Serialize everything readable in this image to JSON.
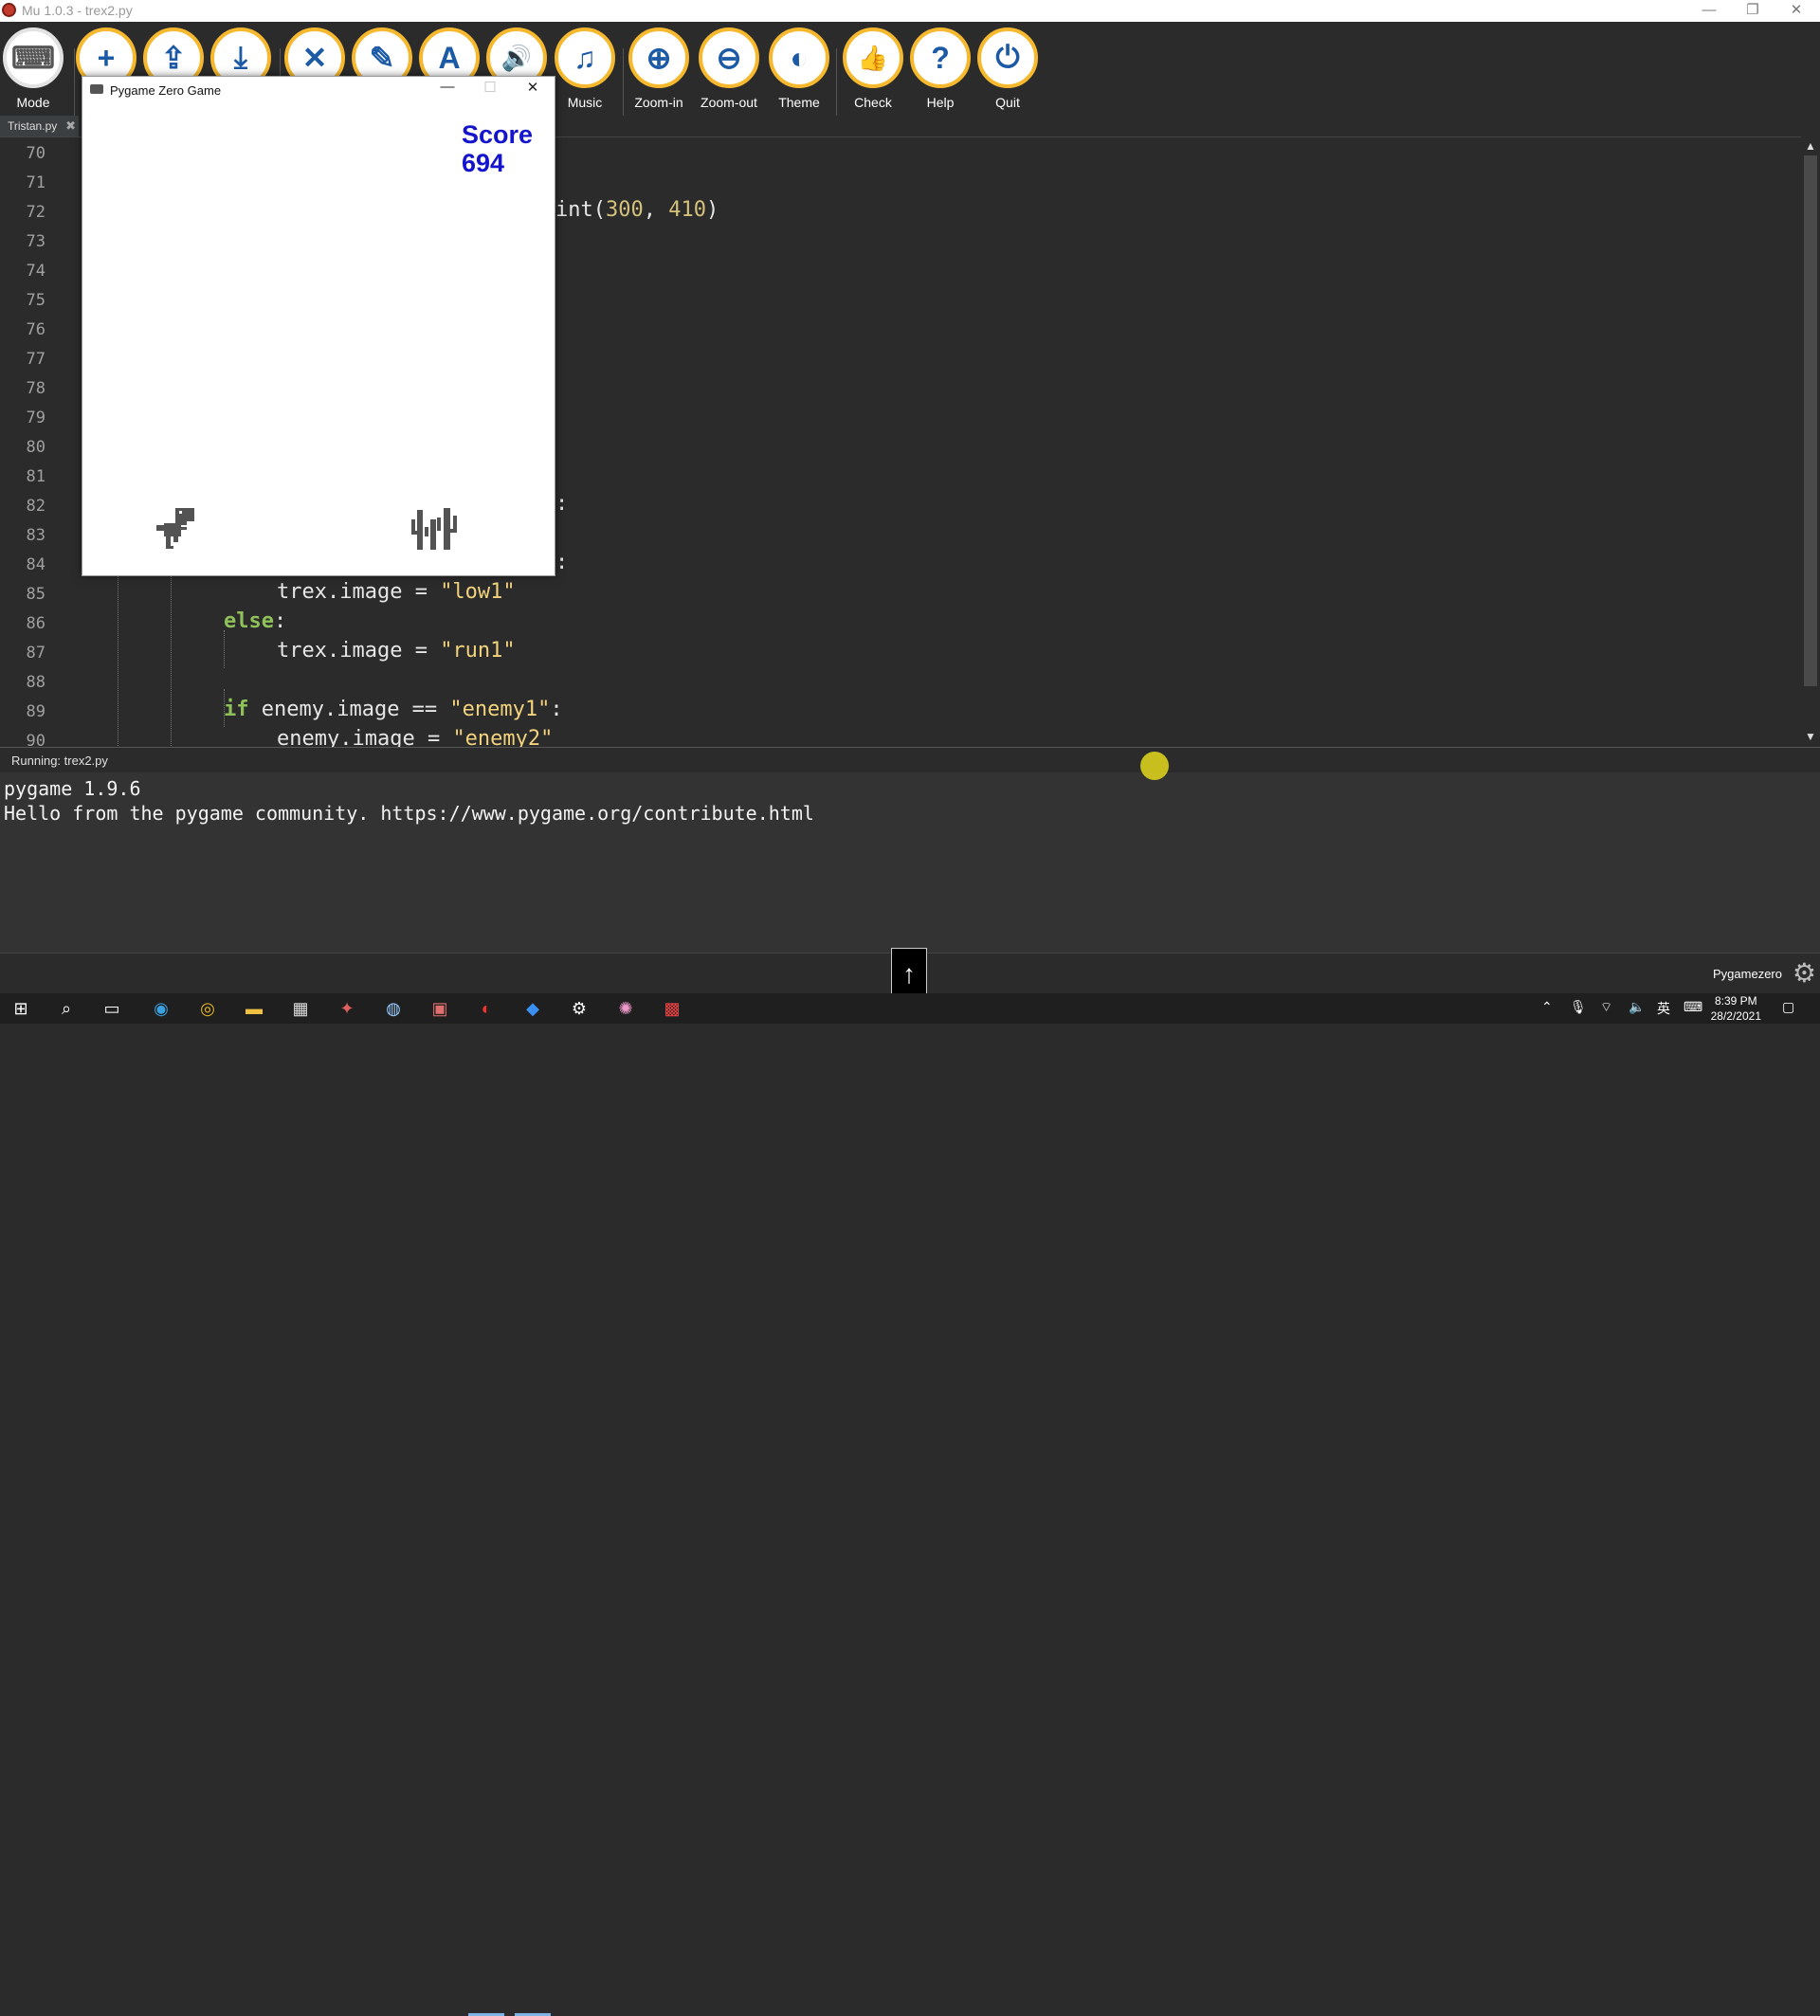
{
  "window": {
    "title": "Mu 1.0.3 - trex2.py"
  },
  "toolbar": {
    "buttons": [
      {
        "label": "Mode",
        "glyph": "⌨"
      },
      {
        "label": "",
        "glyph": "+"
      },
      {
        "label": "",
        "glyph": "⇪"
      },
      {
        "label": "",
        "glyph": "⤓"
      },
      {
        "label": "",
        "glyph": "✕"
      },
      {
        "label": "",
        "glyph": "✎"
      },
      {
        "label": "",
        "glyph": "A"
      },
      {
        "label": "",
        "glyph": "🔊"
      },
      {
        "label": "Music",
        "glyph": "♫"
      },
      {
        "label": "Zoom-in",
        "glyph": "⊕"
      },
      {
        "label": "Zoom-out",
        "glyph": "⊖"
      },
      {
        "label": "Theme",
        "glyph": "◐"
      },
      {
        "label": "Check",
        "glyph": "👍"
      },
      {
        "label": "Help",
        "glyph": "?"
      },
      {
        "label": "Quit",
        "glyph": "⏻"
      }
    ]
  },
  "tabs": [
    {
      "label": "Tristan.py"
    }
  ],
  "editor": {
    "line_numbers": [
      "70",
      "71",
      "72",
      "73",
      "74",
      "75",
      "76",
      "77",
      "78",
      "79",
      "80",
      "81",
      "82",
      "83",
      "84",
      "85",
      "86",
      "87",
      "88",
      "89",
      "90"
    ],
    "fragments": {
      "l72": "int(",
      "l72_num1": "300",
      "l72_sep": ", ",
      "l72_num2": "410",
      "l72_close": ")",
      "l82_colon": ":",
      "l84_colon": ":",
      "l85_code": "trex.image = ",
      "l85_str": "\"low1\"",
      "l86_kw": "else",
      "l86_colon": ":",
      "l87_code": "trex.image = ",
      "l87_str": "\"run1\"",
      "l89_kw": "if",
      "l89_code": " enemy.image == ",
      "l89_str": "\"enemy1\"",
      "l89_colon": ":",
      "l90_code": "enemy.image = ",
      "l90_str": "\"enemy2\""
    }
  },
  "repl": {
    "status": "Running: trex2.py",
    "lines": [
      "pygame 1.9.6",
      "Hello from the pygame community. https://www.pygame.org/contribute.html"
    ]
  },
  "game_window": {
    "title": "Pygame Zero Game",
    "score_label": "Score",
    "score_value": "694"
  },
  "statusbar": {
    "mode": "Pygamezero"
  },
  "upbutton": {
    "glyph": "↑"
  },
  "taskbar": {
    "time": "8:39 PM",
    "date": "28/2/2021",
    "lang": "英"
  },
  "colors": {
    "accent": "#f5b82e",
    "score": "#1414cc",
    "editor_bg": "#2b2b2b"
  }
}
